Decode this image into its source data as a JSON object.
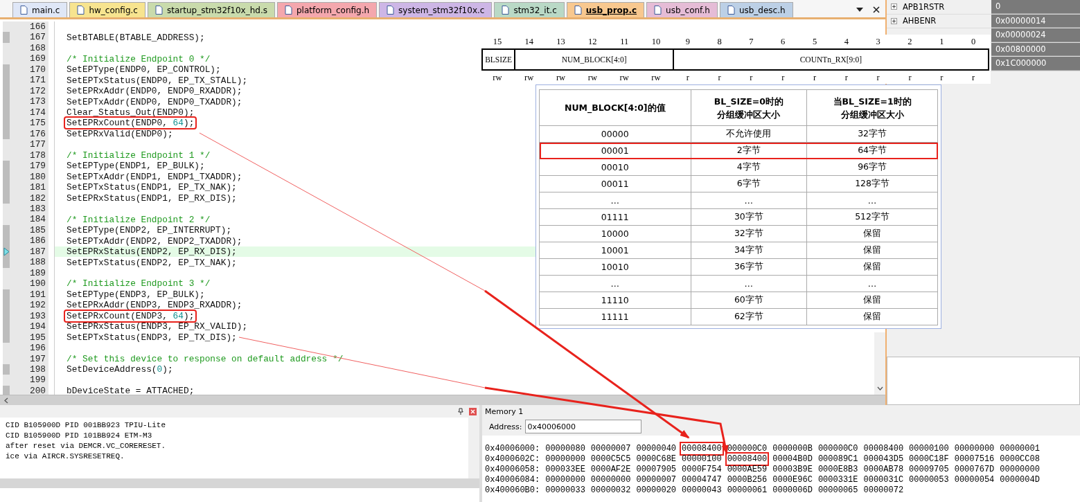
{
  "tabs": [
    {
      "label": "main.c",
      "color": "#dfe7f7",
      "selected": false
    },
    {
      "label": "hw_config.c",
      "color": "#f7e48f",
      "selected": false
    },
    {
      "label": "startup_stm32f10x_hd.s",
      "color": "#c9dbac",
      "selected": false
    },
    {
      "label": "platform_config.h",
      "color": "#f4a7ad",
      "selected": false
    },
    {
      "label": "system_stm32f10x.c",
      "color": "#cdb6e6",
      "selected": false
    },
    {
      "label": "stm32_it.c",
      "color": "#b9d9c6",
      "selected": false
    },
    {
      "label": "usb_prop.c",
      "color": "#f8c88f",
      "selected": true
    },
    {
      "label": "usb_conf.h",
      "color": "#e5bcd6",
      "selected": false
    },
    {
      "label": "usb_desc.h",
      "color": "#bcd0e6",
      "selected": false
    }
  ],
  "editor": {
    "lines": [
      {
        "number": "166",
        "executed": false,
        "current": false
      },
      {
        "number": "167",
        "kind": "code",
        "code": "SetBTABLE(BTABLE_ADDRESS);",
        "executed": true,
        "current": false,
        "boxed": false
      },
      {
        "number": "168",
        "executed": false,
        "current": false
      },
      {
        "number": "169",
        "kind": "comment",
        "code": "/* Initialize Endpoint 0 */",
        "executed": false,
        "current": false,
        "boxed": false
      },
      {
        "number": "170",
        "kind": "code",
        "code": "SetEPType(ENDP0, EP_CONTROL);",
        "executed": true,
        "current": false,
        "boxed": false
      },
      {
        "number": "171",
        "kind": "code",
        "code": "SetEPTxStatus(ENDP0, EP_TX_STALL);",
        "executed": true,
        "current": false,
        "boxed": false
      },
      {
        "number": "172",
        "kind": "code",
        "code": "SetEPRxAddr(ENDP0, ENDP0_RXADDR);",
        "executed": true,
        "current": false,
        "boxed": false
      },
      {
        "number": "173",
        "kind": "code",
        "code": "SetEPTxAddr(ENDP0, ENDP0_TXADDR);",
        "executed": true,
        "current": false,
        "boxed": false
      },
      {
        "number": "174",
        "kind": "code",
        "code": "Clear_Status_Out(ENDP0);",
        "executed": true,
        "current": false,
        "boxed": false
      },
      {
        "number": "175",
        "kind": "code",
        "parts": [
          {
            "text": "SetEPRxCount(ENDP0, "
          },
          {
            "text": "64",
            "kind": "number"
          },
          {
            "text": ");"
          }
        ],
        "executed": true,
        "current": false,
        "boxed": true
      },
      {
        "number": "176",
        "kind": "code",
        "code": "SetEPRxValid(ENDP0);",
        "executed": true,
        "current": false,
        "boxed": false
      },
      {
        "number": "177",
        "executed": false,
        "current": false
      },
      {
        "number": "178",
        "kind": "comment",
        "code": "/* Initialize Endpoint 1 */",
        "executed": false,
        "current": false,
        "boxed": false
      },
      {
        "number": "179",
        "kind": "code",
        "code": "SetEPType(ENDP1, EP_BULK);",
        "executed": true,
        "current": false,
        "boxed": false
      },
      {
        "number": "180",
        "kind": "code",
        "code": "SetEPTxAddr(ENDP1, ENDP1_TXADDR);",
        "executed": true,
        "current": false,
        "boxed": false
      },
      {
        "number": "181",
        "kind": "code",
        "code": "SetEPTxStatus(ENDP1, EP_TX_NAK);",
        "executed": true,
        "current": false,
        "boxed": false
      },
      {
        "number": "182",
        "kind": "code",
        "code": "SetEPRxStatus(ENDP1, EP_RX_DIS);",
        "executed": true,
        "current": false,
        "boxed": false
      },
      {
        "number": "183",
        "executed": false,
        "current": false
      },
      {
        "number": "184",
        "kind": "comment",
        "code": "/* Initialize Endpoint 2 */",
        "executed": false,
        "current": false,
        "boxed": false
      },
      {
        "number": "185",
        "kind": "code",
        "code": "SetEPType(ENDP2, EP_INTERRUPT);",
        "executed": true,
        "current": false,
        "boxed": false
      },
      {
        "number": "186",
        "kind": "code",
        "code": "SetEPTxAddr(ENDP2, ENDP2_TXADDR);",
        "executed": true,
        "current": false,
        "boxed": false
      },
      {
        "number": "187",
        "kind": "code",
        "code": "SetEPRxStatus(ENDP2, EP_RX_DIS);",
        "executed": true,
        "current": true,
        "boxed": false
      },
      {
        "number": "188",
        "kind": "code",
        "code": "SetEPTxStatus(ENDP2, EP_TX_NAK);",
        "executed": true,
        "current": false,
        "boxed": false
      },
      {
        "number": "189",
        "executed": false,
        "current": false
      },
      {
        "number": "190",
        "kind": "comment",
        "code": "/* Initialize Endpoint 3 */",
        "executed": false,
        "current": false,
        "boxed": false
      },
      {
        "number": "191",
        "kind": "code",
        "code": "SetEPType(ENDP3, EP_BULK);",
        "executed": true,
        "current": false,
        "boxed": false
      },
      {
        "number": "192",
        "kind": "code",
        "code": "SetEPRxAddr(ENDP3, ENDP3_RXADDR);",
        "executed": true,
        "current": false,
        "boxed": false
      },
      {
        "number": "193",
        "kind": "code",
        "parts": [
          {
            "text": "SetEPRxCount(ENDP3, "
          },
          {
            "text": "64",
            "kind": "number"
          },
          {
            "text": ");"
          }
        ],
        "executed": true,
        "current": false,
        "boxed": true
      },
      {
        "number": "194",
        "kind": "code",
        "code": "SetEPRxStatus(ENDP3, EP_RX_VALID);",
        "executed": true,
        "current": false,
        "boxed": false
      },
      {
        "number": "195",
        "kind": "code",
        "code": "SetEPTxStatus(ENDP3, EP_TX_DIS);",
        "executed": true,
        "current": false,
        "boxed": false
      },
      {
        "number": "196",
        "executed": false,
        "current": false
      },
      {
        "number": "197",
        "kind": "comment",
        "code": "/* Set this device to response on default address */",
        "executed": false,
        "current": false,
        "boxed": false
      },
      {
        "number": "198",
        "kind": "code",
        "parts": [
          {
            "text": "SetDeviceAddress("
          },
          {
            "text": "0",
            "kind": "number"
          },
          {
            "text": ");"
          }
        ],
        "executed": true,
        "current": false,
        "boxed": false
      },
      {
        "number": "199",
        "executed": false,
        "current": false
      },
      {
        "number": "200",
        "kind": "code",
        "code": "bDeviceState = ATTACHED;",
        "executed": true,
        "current": false,
        "boxed": false
      }
    ]
  },
  "registers": [
    {
      "name": "APB1RSTR",
      "value": "0"
    },
    {
      "name": "AHBENR",
      "value": "0x00000014"
    },
    {
      "value": "0x00000024"
    },
    {
      "value": "0x00800000"
    },
    {
      "value": "0x1C000000"
    }
  ],
  "register_diagram": {
    "bits": [
      "15",
      "14",
      "13",
      "12",
      "11",
      "10",
      "9",
      "8",
      "7",
      "6",
      "5",
      "4",
      "3",
      "2",
      "1",
      "0"
    ],
    "fields": [
      {
        "label": "BLSIZE"
      },
      {
        "label": "NUM_BLOCK[4:0]"
      },
      {
        "label": "COUNTn_RX[9:0]"
      }
    ],
    "access": [
      "rw",
      "rw",
      "rw",
      "rw",
      "rw",
      "rw",
      "r",
      "r",
      "r",
      "r",
      "r",
      "r",
      "r",
      "r",
      "r",
      "r"
    ]
  },
  "block_table": {
    "columns": [
      {
        "lines": [
          "NUM_BLOCK[4:0]的值"
        ]
      },
      {
        "lines": [
          "BL_SIZE=0时的",
          "分组缓冲区大小"
        ]
      },
      {
        "lines": [
          "当BL_SIZE=1时的",
          "分组缓冲区大小"
        ]
      }
    ],
    "rows": [
      {
        "cells": [
          "00000",
          "不允许使用",
          "32字节"
        ],
        "boxed": false
      },
      {
        "cells": [
          "00001",
          "2字节",
          "64字节"
        ],
        "boxed": true
      },
      {
        "cells": [
          "00010",
          "4字节",
          "96字节"
        ],
        "boxed": false
      },
      {
        "cells": [
          "00011",
          "6字节",
          "128字节"
        ],
        "boxed": false
      },
      {
        "cells": [
          "…",
          "…",
          "…"
        ],
        "boxed": false
      },
      {
        "cells": [
          "01111",
          "30字节",
          "512字节"
        ],
        "boxed": false
      },
      {
        "cells": [
          "10000",
          "32字节",
          "保留"
        ],
        "boxed": false
      },
      {
        "cells": [
          "10001",
          "34字节",
          "保留"
        ],
        "boxed": false
      },
      {
        "cells": [
          "10010",
          "36字节",
          "保留"
        ],
        "boxed": false
      },
      {
        "cells": [
          "…",
          "…",
          "…"
        ],
        "boxed": false
      },
      {
        "cells": [
          "11110",
          "60字节",
          "保留"
        ],
        "boxed": false
      },
      {
        "cells": [
          "11111",
          "62字节",
          "保留"
        ],
        "boxed": false
      }
    ]
  },
  "output": {
    "lines": [
      "CID B105900D PID 001BB923 TPIU-Lite",
      "CID B105900D PID 101BB924 ETM-M3",
      "after reset via DEMCR.VC_CORERESET.",
      "ice via AIRCR.SYSRESETREQ."
    ]
  },
  "memory": {
    "title": "Memory 1",
    "address_label": "Address:",
    "address": "0x40006000",
    "rows": [
      {
        "address": "0x40006000:",
        "cells": [
          {
            "value": "00000080",
            "boxed": false
          },
          {
            "value": "00000007",
            "boxed": false
          },
          {
            "value": "00000040",
            "boxed": false
          },
          {
            "value": "00008400",
            "boxed": true
          },
          {
            "value": "000000C0",
            "boxed": false
          },
          {
            "value": "0000000B",
            "boxed": false
          },
          {
            "value": "000000C0",
            "boxed": false
          },
          {
            "value": "00008400",
            "boxed": false
          },
          {
            "value": "00000100",
            "boxed": false
          },
          {
            "value": "00000000",
            "boxed": false
          },
          {
            "value": "00000001",
            "boxed": false
          }
        ]
      },
      {
        "address": "0x4000602C:",
        "cells": [
          {
            "value": "00000000",
            "boxed": false
          },
          {
            "value": "0000C5C5",
            "boxed": false
          },
          {
            "value": "0000C68E",
            "boxed": false
          },
          {
            "value": "00000100",
            "boxed": false
          },
          {
            "value": "00008400",
            "boxed": true
          },
          {
            "value": "00004B0D",
            "boxed": false
          },
          {
            "value": "000089C1",
            "boxed": false
          },
          {
            "value": "000043D5",
            "boxed": false
          },
          {
            "value": "0000C18F",
            "boxed": false
          },
          {
            "value": "00007516",
            "boxed": false
          },
          {
            "value": "0000CC08",
            "boxed": false
          }
        ]
      },
      {
        "address": "0x40006058:",
        "cells": [
          {
            "value": "000033EE",
            "boxed": false
          },
          {
            "value": "0000AF2E",
            "boxed": false
          },
          {
            "value": "00007905",
            "boxed": false
          },
          {
            "value": "0000F754",
            "boxed": false
          },
          {
            "value": "0000AE59",
            "boxed": false
          },
          {
            "value": "00003B9E",
            "boxed": false
          },
          {
            "value": "0000E8B3",
            "boxed": false
          },
          {
            "value": "0000AB78",
            "boxed": false
          },
          {
            "value": "00009705",
            "boxed": false
          },
          {
            "value": "0000767D",
            "boxed": false
          },
          {
            "value": "00000000",
            "boxed": false
          }
        ]
      },
      {
        "address": "0x40006084:",
        "cells": [
          {
            "value": "00000000",
            "boxed": false
          },
          {
            "value": "00000000",
            "boxed": false
          },
          {
            "value": "00000007",
            "boxed": false
          },
          {
            "value": "00004747",
            "boxed": false
          },
          {
            "value": "0000B256",
            "boxed": false
          },
          {
            "value": "0000E96C",
            "boxed": false
          },
          {
            "value": "0000331E",
            "boxed": false
          },
          {
            "value": "0000031C",
            "boxed": false
          },
          {
            "value": "00000053",
            "boxed": false
          },
          {
            "value": "00000054",
            "boxed": false
          },
          {
            "value": "0000004D",
            "boxed": false
          }
        ]
      },
      {
        "address": "0x400060B0:",
        "cells": [
          {
            "value": "00000033",
            "boxed": false
          },
          {
            "value": "00000032",
            "boxed": false
          },
          {
            "value": "00000020",
            "boxed": false
          },
          {
            "value": "00000043",
            "boxed": false
          },
          {
            "value": "00000061",
            "boxed": false
          },
          {
            "value": "0000006D",
            "boxed": false
          },
          {
            "value": "00000065",
            "boxed": false
          },
          {
            "value": "00000072",
            "boxed": false
          }
        ]
      }
    ]
  }
}
